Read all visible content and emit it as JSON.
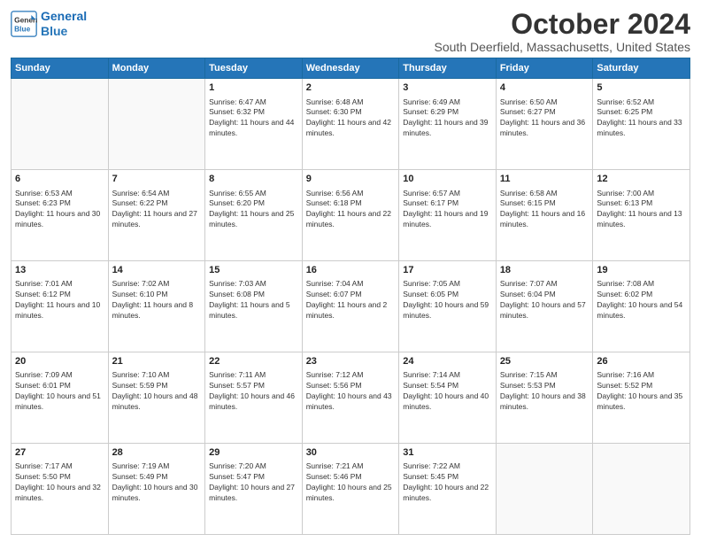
{
  "header": {
    "logo_line1": "General",
    "logo_line2": "Blue",
    "month_title": "October 2024",
    "location": "South Deerfield, Massachusetts, United States"
  },
  "days_of_week": [
    "Sunday",
    "Monday",
    "Tuesday",
    "Wednesday",
    "Thursday",
    "Friday",
    "Saturday"
  ],
  "weeks": [
    [
      {
        "day": "",
        "detail": ""
      },
      {
        "day": "",
        "detail": ""
      },
      {
        "day": "1",
        "detail": "Sunrise: 6:47 AM\nSunset: 6:32 PM\nDaylight: 11 hours and 44 minutes."
      },
      {
        "day": "2",
        "detail": "Sunrise: 6:48 AM\nSunset: 6:30 PM\nDaylight: 11 hours and 42 minutes."
      },
      {
        "day": "3",
        "detail": "Sunrise: 6:49 AM\nSunset: 6:29 PM\nDaylight: 11 hours and 39 minutes."
      },
      {
        "day": "4",
        "detail": "Sunrise: 6:50 AM\nSunset: 6:27 PM\nDaylight: 11 hours and 36 minutes."
      },
      {
        "day": "5",
        "detail": "Sunrise: 6:52 AM\nSunset: 6:25 PM\nDaylight: 11 hours and 33 minutes."
      }
    ],
    [
      {
        "day": "6",
        "detail": "Sunrise: 6:53 AM\nSunset: 6:23 PM\nDaylight: 11 hours and 30 minutes."
      },
      {
        "day": "7",
        "detail": "Sunrise: 6:54 AM\nSunset: 6:22 PM\nDaylight: 11 hours and 27 minutes."
      },
      {
        "day": "8",
        "detail": "Sunrise: 6:55 AM\nSunset: 6:20 PM\nDaylight: 11 hours and 25 minutes."
      },
      {
        "day": "9",
        "detail": "Sunrise: 6:56 AM\nSunset: 6:18 PM\nDaylight: 11 hours and 22 minutes."
      },
      {
        "day": "10",
        "detail": "Sunrise: 6:57 AM\nSunset: 6:17 PM\nDaylight: 11 hours and 19 minutes."
      },
      {
        "day": "11",
        "detail": "Sunrise: 6:58 AM\nSunset: 6:15 PM\nDaylight: 11 hours and 16 minutes."
      },
      {
        "day": "12",
        "detail": "Sunrise: 7:00 AM\nSunset: 6:13 PM\nDaylight: 11 hours and 13 minutes."
      }
    ],
    [
      {
        "day": "13",
        "detail": "Sunrise: 7:01 AM\nSunset: 6:12 PM\nDaylight: 11 hours and 10 minutes."
      },
      {
        "day": "14",
        "detail": "Sunrise: 7:02 AM\nSunset: 6:10 PM\nDaylight: 11 hours and 8 minutes."
      },
      {
        "day": "15",
        "detail": "Sunrise: 7:03 AM\nSunset: 6:08 PM\nDaylight: 11 hours and 5 minutes."
      },
      {
        "day": "16",
        "detail": "Sunrise: 7:04 AM\nSunset: 6:07 PM\nDaylight: 11 hours and 2 minutes."
      },
      {
        "day": "17",
        "detail": "Sunrise: 7:05 AM\nSunset: 6:05 PM\nDaylight: 10 hours and 59 minutes."
      },
      {
        "day": "18",
        "detail": "Sunrise: 7:07 AM\nSunset: 6:04 PM\nDaylight: 10 hours and 57 minutes."
      },
      {
        "day": "19",
        "detail": "Sunrise: 7:08 AM\nSunset: 6:02 PM\nDaylight: 10 hours and 54 minutes."
      }
    ],
    [
      {
        "day": "20",
        "detail": "Sunrise: 7:09 AM\nSunset: 6:01 PM\nDaylight: 10 hours and 51 minutes."
      },
      {
        "day": "21",
        "detail": "Sunrise: 7:10 AM\nSunset: 5:59 PM\nDaylight: 10 hours and 48 minutes."
      },
      {
        "day": "22",
        "detail": "Sunrise: 7:11 AM\nSunset: 5:57 PM\nDaylight: 10 hours and 46 minutes."
      },
      {
        "day": "23",
        "detail": "Sunrise: 7:12 AM\nSunset: 5:56 PM\nDaylight: 10 hours and 43 minutes."
      },
      {
        "day": "24",
        "detail": "Sunrise: 7:14 AM\nSunset: 5:54 PM\nDaylight: 10 hours and 40 minutes."
      },
      {
        "day": "25",
        "detail": "Sunrise: 7:15 AM\nSunset: 5:53 PM\nDaylight: 10 hours and 38 minutes."
      },
      {
        "day": "26",
        "detail": "Sunrise: 7:16 AM\nSunset: 5:52 PM\nDaylight: 10 hours and 35 minutes."
      }
    ],
    [
      {
        "day": "27",
        "detail": "Sunrise: 7:17 AM\nSunset: 5:50 PM\nDaylight: 10 hours and 32 minutes."
      },
      {
        "day": "28",
        "detail": "Sunrise: 7:19 AM\nSunset: 5:49 PM\nDaylight: 10 hours and 30 minutes."
      },
      {
        "day": "29",
        "detail": "Sunrise: 7:20 AM\nSunset: 5:47 PM\nDaylight: 10 hours and 27 minutes."
      },
      {
        "day": "30",
        "detail": "Sunrise: 7:21 AM\nSunset: 5:46 PM\nDaylight: 10 hours and 25 minutes."
      },
      {
        "day": "31",
        "detail": "Sunrise: 7:22 AM\nSunset: 5:45 PM\nDaylight: 10 hours and 22 minutes."
      },
      {
        "day": "",
        "detail": ""
      },
      {
        "day": "",
        "detail": ""
      }
    ]
  ]
}
